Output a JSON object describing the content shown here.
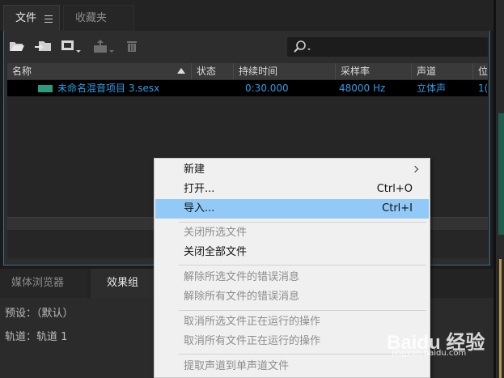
{
  "tabs": {
    "files": "文件",
    "favorites": "收藏夹"
  },
  "table": {
    "columns": [
      "名称",
      "状态",
      "持续时间",
      "采样率",
      "声道",
      "位"
    ],
    "rows": [
      {
        "name": "未命名混音项目 3.sesx",
        "status": "",
        "duration": "0:30.000",
        "sample_rate": "48000 Hz",
        "channels": "立体声",
        "bit": "1("
      }
    ]
  },
  "lower_panel": {
    "tabs": {
      "media": "媒体浏览器",
      "effects": "效果组"
    },
    "preset_label": "预设：（默认）",
    "track_label": "轨道：轨道 1"
  },
  "context_menu": {
    "items": [
      {
        "label": "新建",
        "shortcut": "",
        "submenu": true,
        "disabled": false,
        "highlighted": false
      },
      {
        "label": "打开...",
        "shortcut": "Ctrl+O",
        "submenu": false,
        "disabled": false,
        "highlighted": false
      },
      {
        "label": "导入...",
        "shortcut": "Ctrl+I",
        "submenu": false,
        "disabled": false,
        "highlighted": true
      },
      {
        "label": "关闭所选文件",
        "shortcut": "",
        "submenu": false,
        "disabled": true,
        "highlighted": false
      },
      {
        "label": "关闭全部文件",
        "shortcut": "",
        "submenu": false,
        "disabled": false,
        "highlighted": false
      },
      {
        "label": "解除所选文件的错误消息",
        "shortcut": "",
        "submenu": false,
        "disabled": true,
        "highlighted": false
      },
      {
        "label": "解除所有文件的错误消息",
        "shortcut": "",
        "submenu": false,
        "disabled": true,
        "highlighted": false
      },
      {
        "label": "取消所选文件正在运行的操作",
        "shortcut": "",
        "submenu": false,
        "disabled": true,
        "highlighted": false
      },
      {
        "label": "取消所有文件正在运行的操作",
        "shortcut": "",
        "submenu": false,
        "disabled": true,
        "highlighted": false
      },
      {
        "label": "提取声道到单声道文件",
        "shortcut": "",
        "submenu": false,
        "disabled": true,
        "highlighted": false
      }
    ]
  },
  "watermark": {
    "text": "Baidu 经验",
    "sub": "jingyan.baidu.com"
  },
  "colors": {
    "selected_text": "#2d9de6",
    "highlight": "#91c9f7",
    "panel_border": "#3b6d8f",
    "file_icon": "#2b9b7f"
  },
  "icons": [
    "open-folder-icon",
    "import-icon",
    "new-icon",
    "export-icon",
    "delete-icon",
    "search-icon",
    "menu-icon",
    "sort-ascending-icon",
    "multitrack-file-icon",
    "submenu-arrow-icon"
  ]
}
